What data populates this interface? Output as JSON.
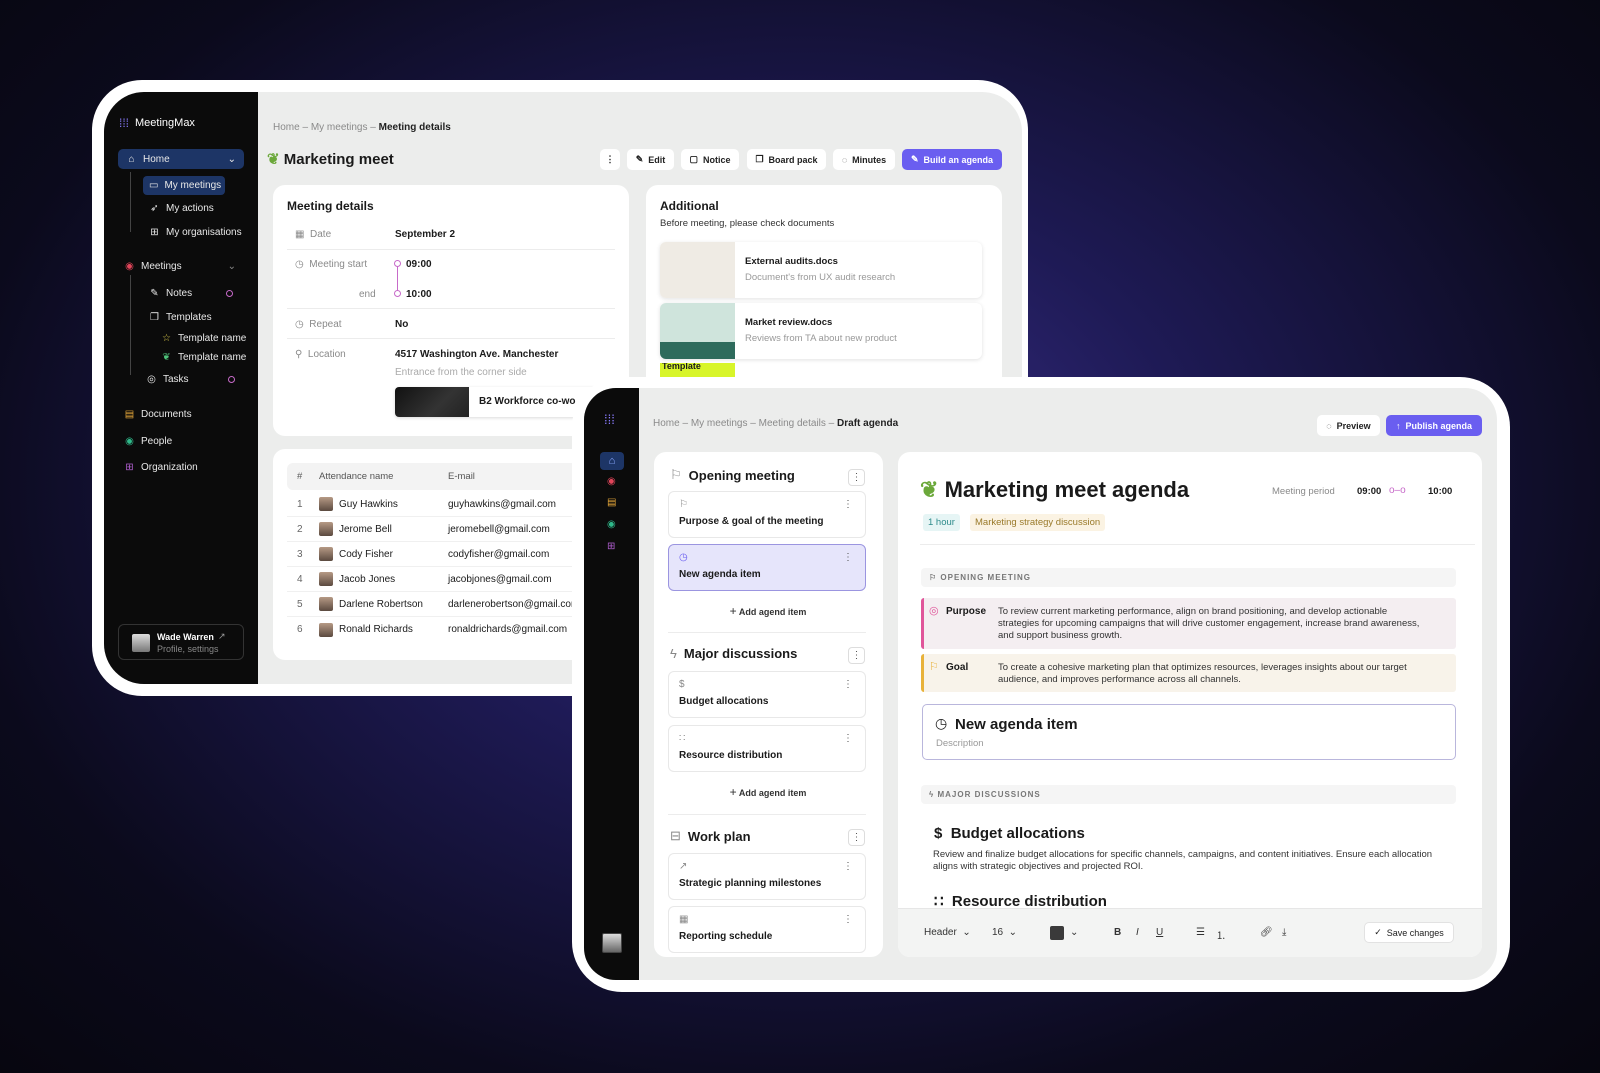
{
  "back": {
    "brand": "MeetingMax",
    "sidebar": {
      "home": "Home",
      "home_children": [
        "My meetings",
        "My actions",
        "My organisations"
      ],
      "meetings": "Meetings",
      "meetings_children": [
        "Notes",
        "Templates",
        "Tasks"
      ],
      "templates": [
        "Template name",
        "Template name"
      ],
      "bottom": [
        "Documents",
        "People",
        "Organization"
      ],
      "profile": {
        "name": "Wade Warren",
        "sub": "Profile, settings"
      }
    },
    "breadcrumb": [
      "Home",
      "My meetings",
      "Meeting details"
    ],
    "title": "Marketing meet",
    "actions": {
      "more": "⋮",
      "edit": "Edit",
      "notice": "Notice",
      "board_pack": "Board pack",
      "minutes": "Minutes",
      "build": "Build an agenda"
    },
    "details": {
      "title": "Meeting details",
      "date_label": "Date",
      "date": "September 2",
      "start_label": "Meeting start",
      "start": "09:00",
      "end_label": "end",
      "end": "10:00",
      "repeat_label": "Repeat",
      "repeat": "No",
      "location_label": "Location",
      "location": "4517 Washington Ave. Manchester",
      "location_note": "Entrance from the corner side",
      "place": "B2 Workforce co-wo"
    },
    "additional": {
      "title": "Additional",
      "subtitle": "Before meeting, please check documents",
      "docs": [
        {
          "name": "External audits.docs",
          "desc": "Document's from UX audit research"
        },
        {
          "name": "Market review.docs",
          "desc": "Reviews from TA about new product"
        }
      ],
      "third_thumb": "Template"
    },
    "attendance": {
      "headers": [
        "#",
        "Attendance name",
        "E-mail"
      ],
      "rows": [
        {
          "n": "1",
          "name": "Guy Hawkins",
          "email": "guyhawkins@gmail.com"
        },
        {
          "n": "2",
          "name": "Jerome Bell",
          "email": "jeromebell@gmail.com"
        },
        {
          "n": "3",
          "name": "Cody Fisher",
          "email": "codyfisher@gmail.com"
        },
        {
          "n": "4",
          "name": "Jacob Jones",
          "email": "jacobjones@gmail.com"
        },
        {
          "n": "5",
          "name": "Darlene Robertson",
          "email": "darlenerobertson@gmail.com"
        },
        {
          "n": "6",
          "name": "Ronald Richards",
          "email": "ronaldrichards@gmail.com"
        }
      ]
    }
  },
  "front": {
    "breadcrumb": [
      "Home",
      "My meetings",
      "Meeting details",
      "Draft agenda"
    ],
    "preview": "Preview",
    "publish": "Publish agenda",
    "sections": [
      {
        "title": "Opening meeting",
        "items": [
          "Purpose & goal of the meeting",
          "New agenda item"
        ]
      },
      {
        "title": "Major discussions",
        "items": [
          "Budget allocations",
          "Resource distribution"
        ]
      },
      {
        "title": "Work plan",
        "items": [
          "Strategic planning milestones",
          "Reporting schedule"
        ]
      }
    ],
    "add_item": "Add agend item",
    "agenda": {
      "title": "Marketing meet agenda",
      "period_label": "Meeting period",
      "start": "09:00",
      "end": "10:00",
      "duration": "1 hour",
      "tag": "Marketing strategy discussion",
      "opening_header": "OPENING MEETING",
      "purpose_label": "Purpose",
      "purpose": "To review current marketing performance, align on brand positioning, and develop actionable strategies for upcoming campaigns that will drive customer engagement, increase brand awareness, and support business growth.",
      "goal_label": "Goal",
      "goal": "To create a cohesive marketing plan that optimizes resources, leverages insights about our target audience, and improves performance across all channels.",
      "new_item_title": "New agenda item",
      "new_item_placeholder": "Description",
      "major_header": "MAJOR DISCUSSIONS",
      "budget_title": "Budget allocations",
      "budget_desc": "Review and finalize budget allocations for specific channels, campaigns, and content initiatives. Ensure each allocation aligns with strategic objectives and projected ROI.",
      "resource_title": "Resource distribution"
    },
    "toolbar": {
      "style": "Header",
      "size": "16",
      "color": "#3a3a3a",
      "save": "Save changes"
    }
  },
  "colors": {
    "accent": "#6a5ef0",
    "purpose": "#e0559a",
    "goal": "#e8b23a",
    "sidebar": "#0b0b0b"
  }
}
